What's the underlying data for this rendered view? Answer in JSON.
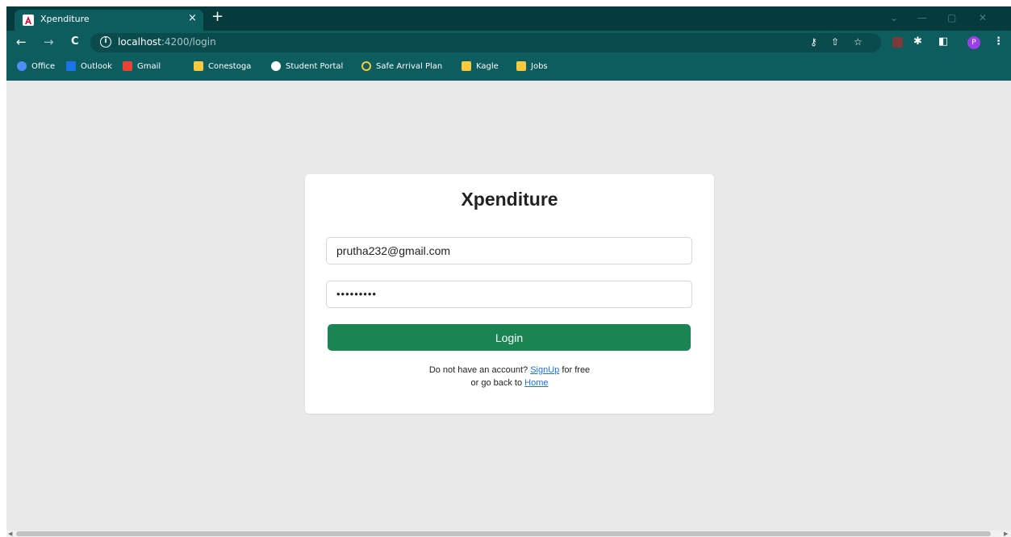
{
  "tab": {
    "title": "Xpenditure",
    "close": "×",
    "new_tab": "+"
  },
  "window_controls": {
    "dropdown": "⌄",
    "minimize": "—",
    "restore": "▢",
    "close": "✕"
  },
  "toolbar": {
    "back": "←",
    "forward": "→",
    "reload": "C",
    "url_host": "localhost",
    "url_path": ":4200/login",
    "avatar_letter": "P",
    "menu": "⋮"
  },
  "bookmarks": [
    {
      "label": "Office",
      "color": "#4f8ef7"
    },
    {
      "label": "Outlook",
      "color": "#1a73e8"
    },
    {
      "label": "Gmail",
      "color": "#ea4335"
    },
    {
      "label": "Conestoga",
      "color": "#f6c93f"
    },
    {
      "label": "Student Portal",
      "color": "#ffffff"
    },
    {
      "label": "Safe Arrival Plan",
      "color": "#f6c93f"
    },
    {
      "label": "Kagle",
      "color": "#f6c93f"
    },
    {
      "label": "Jobs",
      "color": "#f6c93f"
    }
  ],
  "login": {
    "title": "Xpenditure",
    "email_value": "prutha232@gmail.com",
    "password_value": "•••••••••",
    "login_label": "Login",
    "signup_prefix": "Do not have an account?",
    "signup_link": "SignUp",
    "signup_suffix": "for free",
    "home_prefix": "or go back to",
    "home_link": "Home"
  },
  "colors": {
    "chrome_dark": "#053b3d",
    "chrome": "#0d5c5e",
    "login_button": "#1a8453",
    "link": "#1f6fe5",
    "page_bg": "#e9e9e9"
  }
}
